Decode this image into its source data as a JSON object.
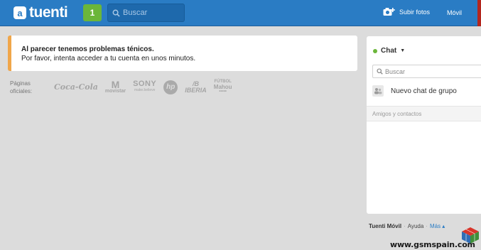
{
  "topbar": {
    "logo_text": "tuenti",
    "logo_badge": "a",
    "notification_count": "1",
    "search_placeholder": "Buscar",
    "upload_label": "Subir fotos",
    "mobile_label": "Móvil"
  },
  "alert": {
    "title": "Al parecer tenemos problemas ténicos.",
    "message": "Por favor, intenta acceder a tu cuenta en unos minutos.",
    "accent_color": "#f0a64a"
  },
  "official": {
    "label_line1": "Páginas",
    "label_line2": "oficiales:",
    "brands": {
      "cocacola": "Coca-Cola",
      "movistar_mark": "M",
      "movistar": "movistar",
      "sony": "SONY",
      "sony_tag": "make.believe",
      "hp": "hp",
      "iberia_mark": "/B",
      "iberia": "IBERIA",
      "futbol_top": "FÚTBOL",
      "futbol_main": "Mahou",
      "futbol_bottom": "•••••"
    }
  },
  "chat": {
    "title": "Chat",
    "status_color": "#6bb63a",
    "search_placeholder": "Buscar",
    "new_group_label": "Nuevo chat de grupo",
    "contacts_label": "Amigos y contactos"
  },
  "footer": {
    "mobile": "Tuenti Móvil",
    "sep1": "·",
    "help": "Ayuda",
    "sep2": "·",
    "more": "Más ▴"
  },
  "watermark": {
    "text": "www.gsmspain.com"
  },
  "colors": {
    "topbar": "#2a7cc4",
    "background": "#dcdcdc",
    "notif_green": "#6bb63a"
  }
}
